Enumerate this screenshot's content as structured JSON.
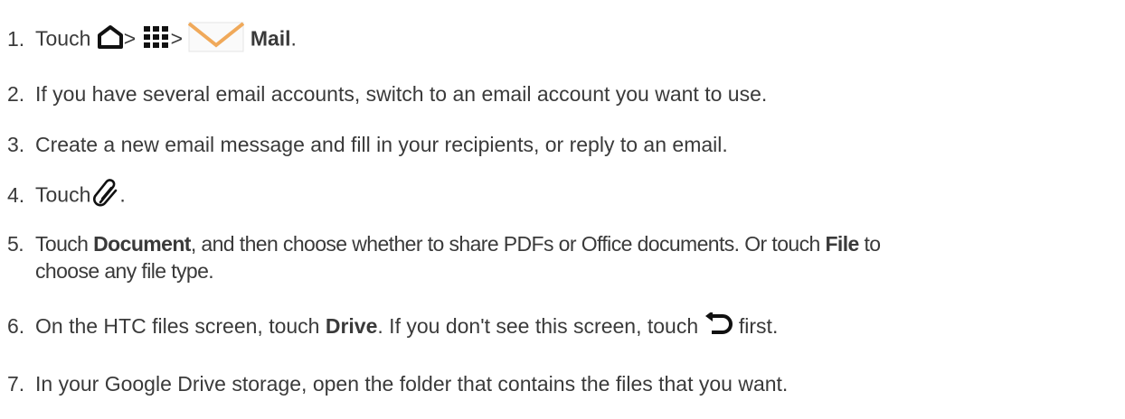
{
  "steps": [
    {
      "num": "1.",
      "touch": "Touch",
      "sep1": ">",
      "sep2": ">",
      "mail": "Mail",
      "period": ".",
      "icons": [
        "home-icon",
        "apps-grid-icon",
        "mail-envelope-icon"
      ]
    },
    {
      "num": "2.",
      "text": "If you have several email accounts, switch to an email account you want to use."
    },
    {
      "num": "3.",
      "text": "Create a new email message and fill in your recipients, or reply to an email."
    },
    {
      "num": "4.",
      "touch": "Touch",
      "period": ".",
      "icons": [
        "paperclip-icon"
      ]
    },
    {
      "num": "5.",
      "touch": "Touch",
      "document": "Document",
      "mid": ", and then choose whether to share PDFs or Office documents. Or touch",
      "file": "File",
      "to": "to",
      "cont": "choose any file type."
    },
    {
      "num": "6.",
      "pre": "On the HTC files screen, touch",
      "drive": "Drive",
      "mid": ". If you don't see this screen, touch",
      "post": "first.",
      "icons": [
        "back-arrow-icon"
      ]
    },
    {
      "num": "7.",
      "text": "In your Google Drive storage, open the folder that contains the files that you want."
    }
  ],
  "colors": {
    "text": "#3a3a3a",
    "mail_icon": "#f0a95a"
  }
}
